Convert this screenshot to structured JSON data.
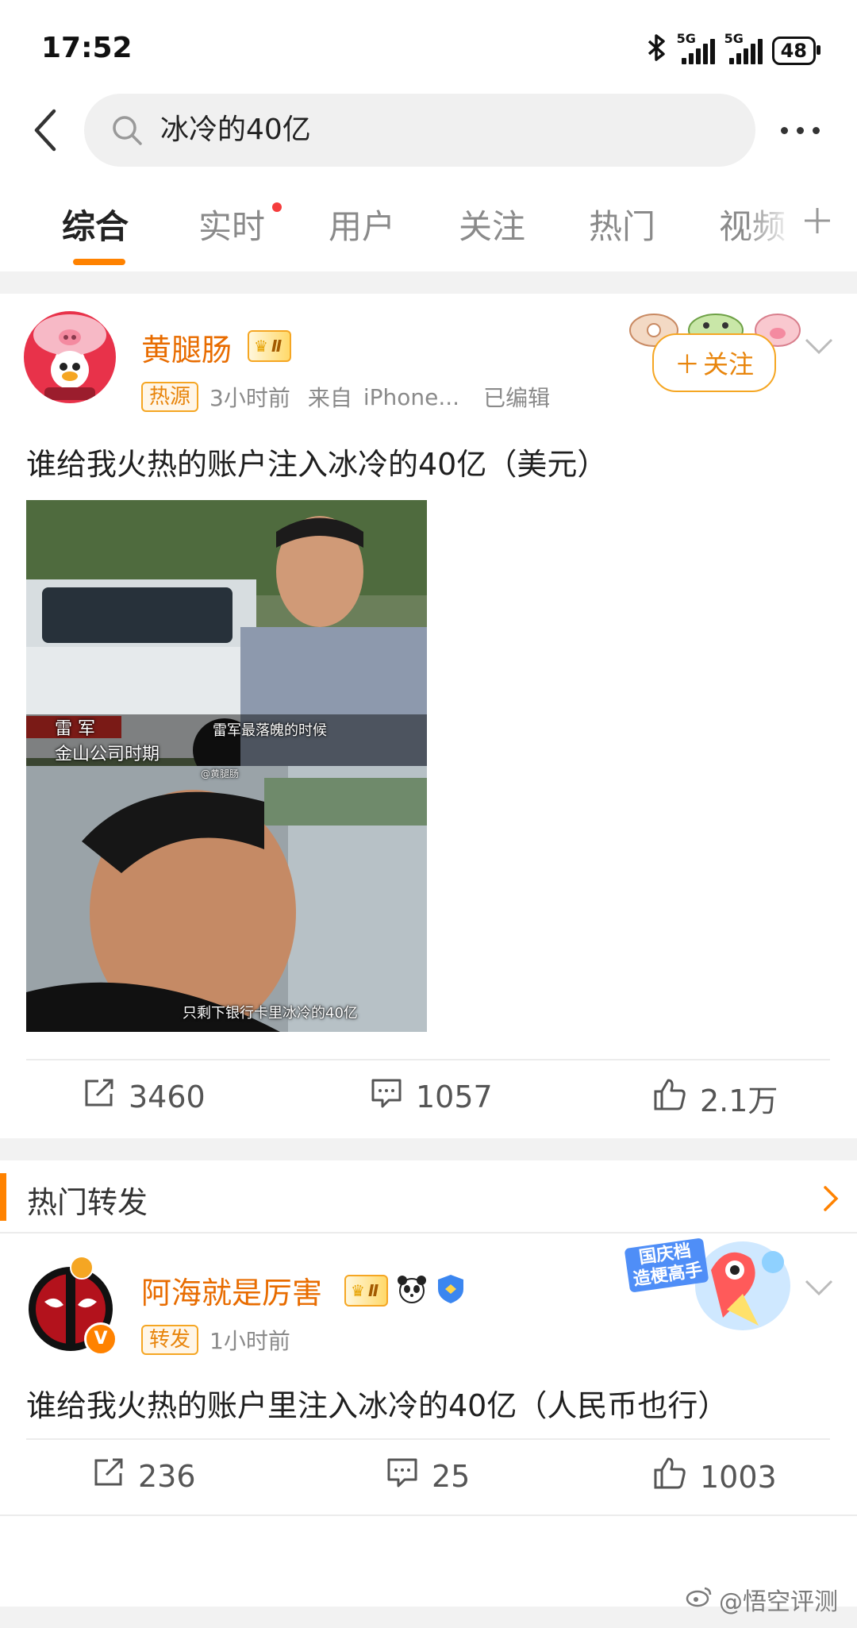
{
  "status_bar": {
    "time": "17:52",
    "network_1": "5G",
    "network_2": "5G",
    "battery": "48"
  },
  "search": {
    "query": "冰冷的40亿"
  },
  "tabs": [
    {
      "label": "综合",
      "active": true
    },
    {
      "label": "实时",
      "active": false,
      "has_dot": true
    },
    {
      "label": "用户",
      "active": false
    },
    {
      "label": "关注",
      "active": false
    },
    {
      "label": "热门",
      "active": false
    },
    {
      "label": "视频",
      "active": false
    }
  ],
  "post": {
    "username": "黄腿肠",
    "badge": "Ⅱ",
    "source_tag": "热源",
    "time": "3小时前",
    "from_label": "来自",
    "device": "iPhone...",
    "edited": "已编辑",
    "follow_label": "关注",
    "text": "谁给我火热的账户注入冰冷的40亿（美元）",
    "image": {
      "caption_name": "雷 军",
      "caption_company": "金山公司时期",
      "caption_top": "雷军最落魄的时候",
      "caption_bottom": "只剩下银行卡里冰冷的40亿",
      "watermark": "@黄腿肠"
    },
    "actions": {
      "reposts": "3460",
      "comments": "1057",
      "likes": "2.1万"
    }
  },
  "hot_reposts": {
    "title": "热门转发",
    "item": {
      "username": "阿海就是厉害",
      "badge": "Ⅱ",
      "repost_tag": "转发",
      "time": "1小时前",
      "banner_text_1": "国庆档",
      "banner_text_2": "造梗高手",
      "text": "谁给我火热的账户里注入冰冷的40亿（人民币也行）",
      "actions": {
        "reposts": "236",
        "comments": "25",
        "likes": "1003"
      }
    }
  },
  "watermark": "@悟空评测",
  "colors": {
    "accent": "#ff8200",
    "username": "#e86c00",
    "link": "#3b6fb6"
  }
}
